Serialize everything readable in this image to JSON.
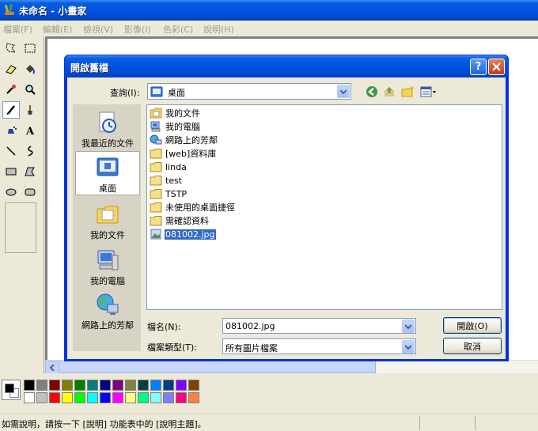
{
  "window": {
    "title": "未命名 - 小畫家"
  },
  "menu": [
    "檔案(F)",
    "編輯(E)",
    "檢視(V)",
    "影像(I)",
    "色彩(C)",
    "說明(H)"
  ],
  "dialog": {
    "title": "開啟舊檔",
    "look_in_label": "查詢(I):",
    "look_in_value": "桌面",
    "places": [
      {
        "label": "我最近的文件",
        "icon": "recent-documents-icon"
      },
      {
        "label": "桌面",
        "icon": "desktop-icon",
        "selected": true
      },
      {
        "label": "我的文件",
        "icon": "my-documents-icon"
      },
      {
        "label": "我的電腦",
        "icon": "my-computer-icon"
      },
      {
        "label": "網路上的芳鄰",
        "icon": "network-places-icon"
      }
    ],
    "files": [
      {
        "name": "我的文件",
        "icon": "my-documents-icon"
      },
      {
        "name": "我的電腦",
        "icon": "my-computer-icon"
      },
      {
        "name": "網路上的芳鄰",
        "icon": "network-places-icon"
      },
      {
        "name": "[web]資料庫",
        "icon": "folder-icon"
      },
      {
        "name": "linda",
        "icon": "folder-icon"
      },
      {
        "name": "test",
        "icon": "folder-icon"
      },
      {
        "name": "TSTP",
        "icon": "folder-icon"
      },
      {
        "name": "未使用的桌面捷徑",
        "icon": "folder-icon"
      },
      {
        "name": "需確認資料",
        "icon": "folder-icon"
      },
      {
        "name": "081002.jpg",
        "icon": "image-file-icon",
        "selected": true
      }
    ],
    "filename_label": "檔名(N):",
    "filename_value": "081002.jpg",
    "filetype_label": "檔案類型(T):",
    "filetype_value": "所有圖片檔案",
    "open_button": "開啟(O)",
    "cancel_button": "取消"
  },
  "palette": {
    "foreground": "#000000",
    "background": "#ffffff",
    "row1": [
      "#000000",
      "#808080",
      "#800000",
      "#808000",
      "#008000",
      "#008080",
      "#000080",
      "#800080",
      "#808040",
      "#004040",
      "#0080ff",
      "#004080",
      "#8000ff",
      "#804000"
    ],
    "row2": [
      "#ffffff",
      "#c0c0c0",
      "#ff0000",
      "#ffff00",
      "#00ff00",
      "#00ffff",
      "#0000ff",
      "#ff00ff",
      "#ffff80",
      "#00ff80",
      "#80ffff",
      "#8080ff",
      "#ff0080",
      "#ff8040"
    ]
  },
  "status": {
    "text": "如需說明，請按一下 [說明] 功能表中的 [說明主題]。"
  }
}
